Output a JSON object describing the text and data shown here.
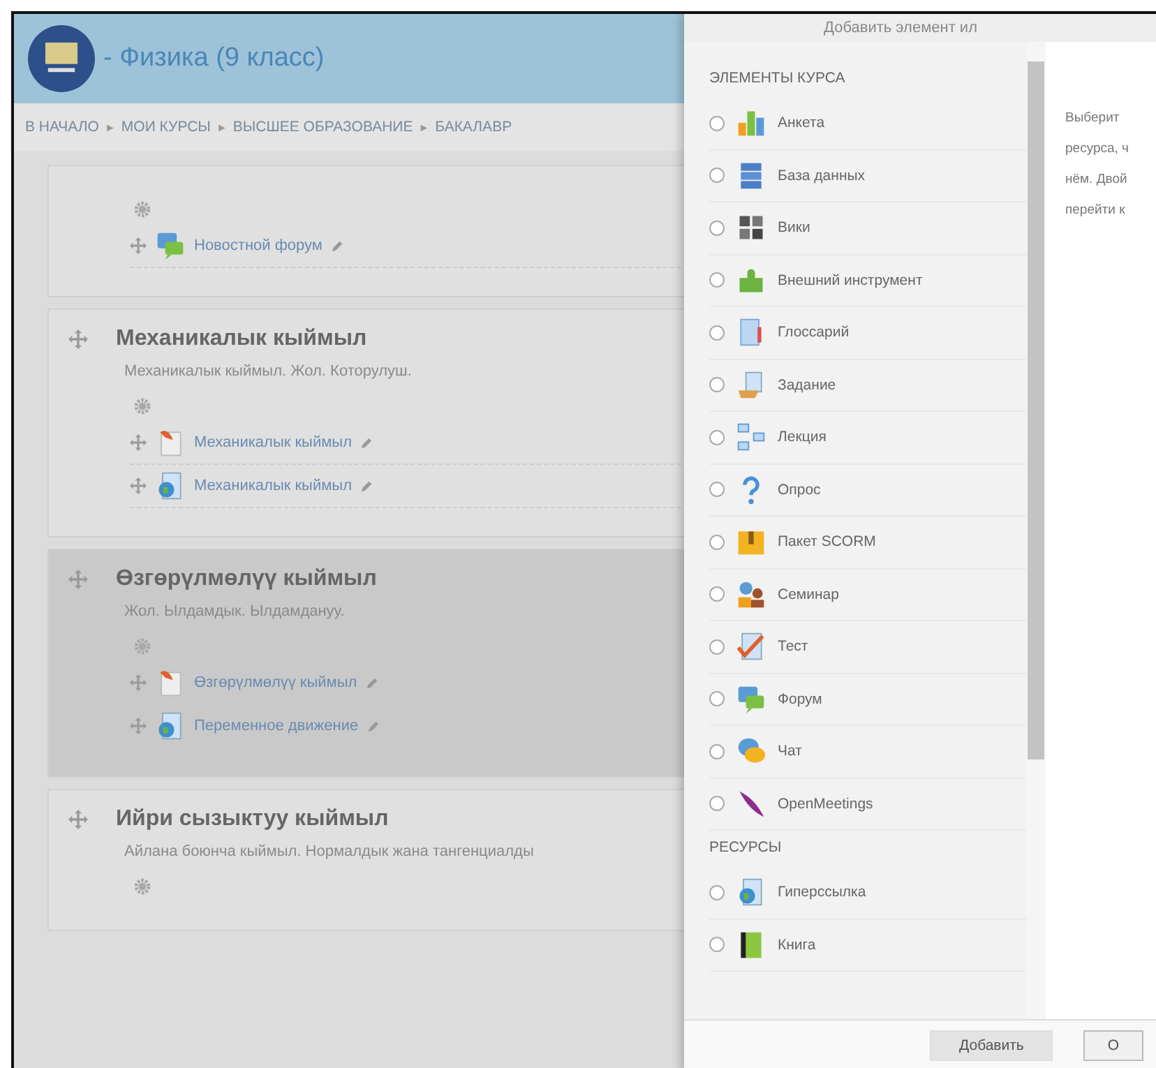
{
  "header": {
    "title": "- Физика (9 класс)"
  },
  "breadcrumb": {
    "separator": "►",
    "items": [
      "В НАЧАЛО",
      "МОИ КУРСЫ",
      "ВЫСШЕЕ ОБРАЗОВАНИЕ",
      "БАКАЛАВР"
    ]
  },
  "sections": [
    {
      "highlighted": false,
      "items": [
        {
          "kind": "forum",
          "label": "Новостной форум"
        }
      ]
    },
    {
      "title": "Механикалык кыймыл",
      "summary": "Механикалык кыймыл. Жол. Которулуш.",
      "highlighted": false,
      "items": [
        {
          "kind": "file",
          "label": "Механикалык кыймыл"
        },
        {
          "kind": "url",
          "label": "Механикалык кыймыл"
        }
      ]
    },
    {
      "title": "Өзгөрүлмөлүү кыймыл",
      "summary": "Жол. Ылдамдык. Ылдамдануу.",
      "highlighted": true,
      "items": [
        {
          "kind": "file",
          "label": "Өзгөрүлмөлүү кыймыл"
        },
        {
          "kind": "url",
          "label": "Переменное движение"
        }
      ]
    },
    {
      "title": "Ийри сызыктуу кыймыл",
      "summary": "Айлана боюнча кыймыл. Нормалдык жана тангенциалды",
      "highlighted": false
    }
  ],
  "dialog": {
    "title": "Добавить элемент ил",
    "groups": [
      {
        "heading": "ЭЛЕМЕНТЫ КУРСА",
        "options": [
          {
            "kind": "feedback",
            "label": "Анкета",
            "selected": false
          },
          {
            "kind": "database",
            "label": "База данных",
            "selected": false
          },
          {
            "kind": "wiki",
            "label": "Вики",
            "selected": false
          },
          {
            "kind": "lti",
            "label": "Внешний инструмент",
            "selected": false
          },
          {
            "kind": "glossary",
            "label": "Глоссарий",
            "selected": false
          },
          {
            "kind": "assign",
            "label": "Задание",
            "selected": false
          },
          {
            "kind": "lesson",
            "label": "Лекция",
            "selected": false
          },
          {
            "kind": "choice",
            "label": "Опрос",
            "selected": false
          },
          {
            "kind": "scorm",
            "label": "Пакет SCORM",
            "selected": false
          },
          {
            "kind": "workshop",
            "label": "Семинар",
            "selected": false
          },
          {
            "kind": "quiz",
            "label": "Тест",
            "selected": false
          },
          {
            "kind": "forum",
            "label": "Форум",
            "selected": false
          },
          {
            "kind": "chat",
            "label": "Чат",
            "selected": false
          },
          {
            "kind": "openmeetings",
            "label": "OpenMeetings",
            "selected": false
          }
        ]
      },
      {
        "heading": "РЕСУРСЫ",
        "options": [
          {
            "kind": "url",
            "label": "Гиперссылка",
            "selected": false
          },
          {
            "kind": "book",
            "label": "Книга",
            "selected": false
          }
        ]
      }
    ],
    "help_lines": [
      "Выберит",
      "ресурса, ч",
      "нём. Двой",
      "перейти к"
    ],
    "buttons": [
      "Добавить",
      "О"
    ]
  }
}
